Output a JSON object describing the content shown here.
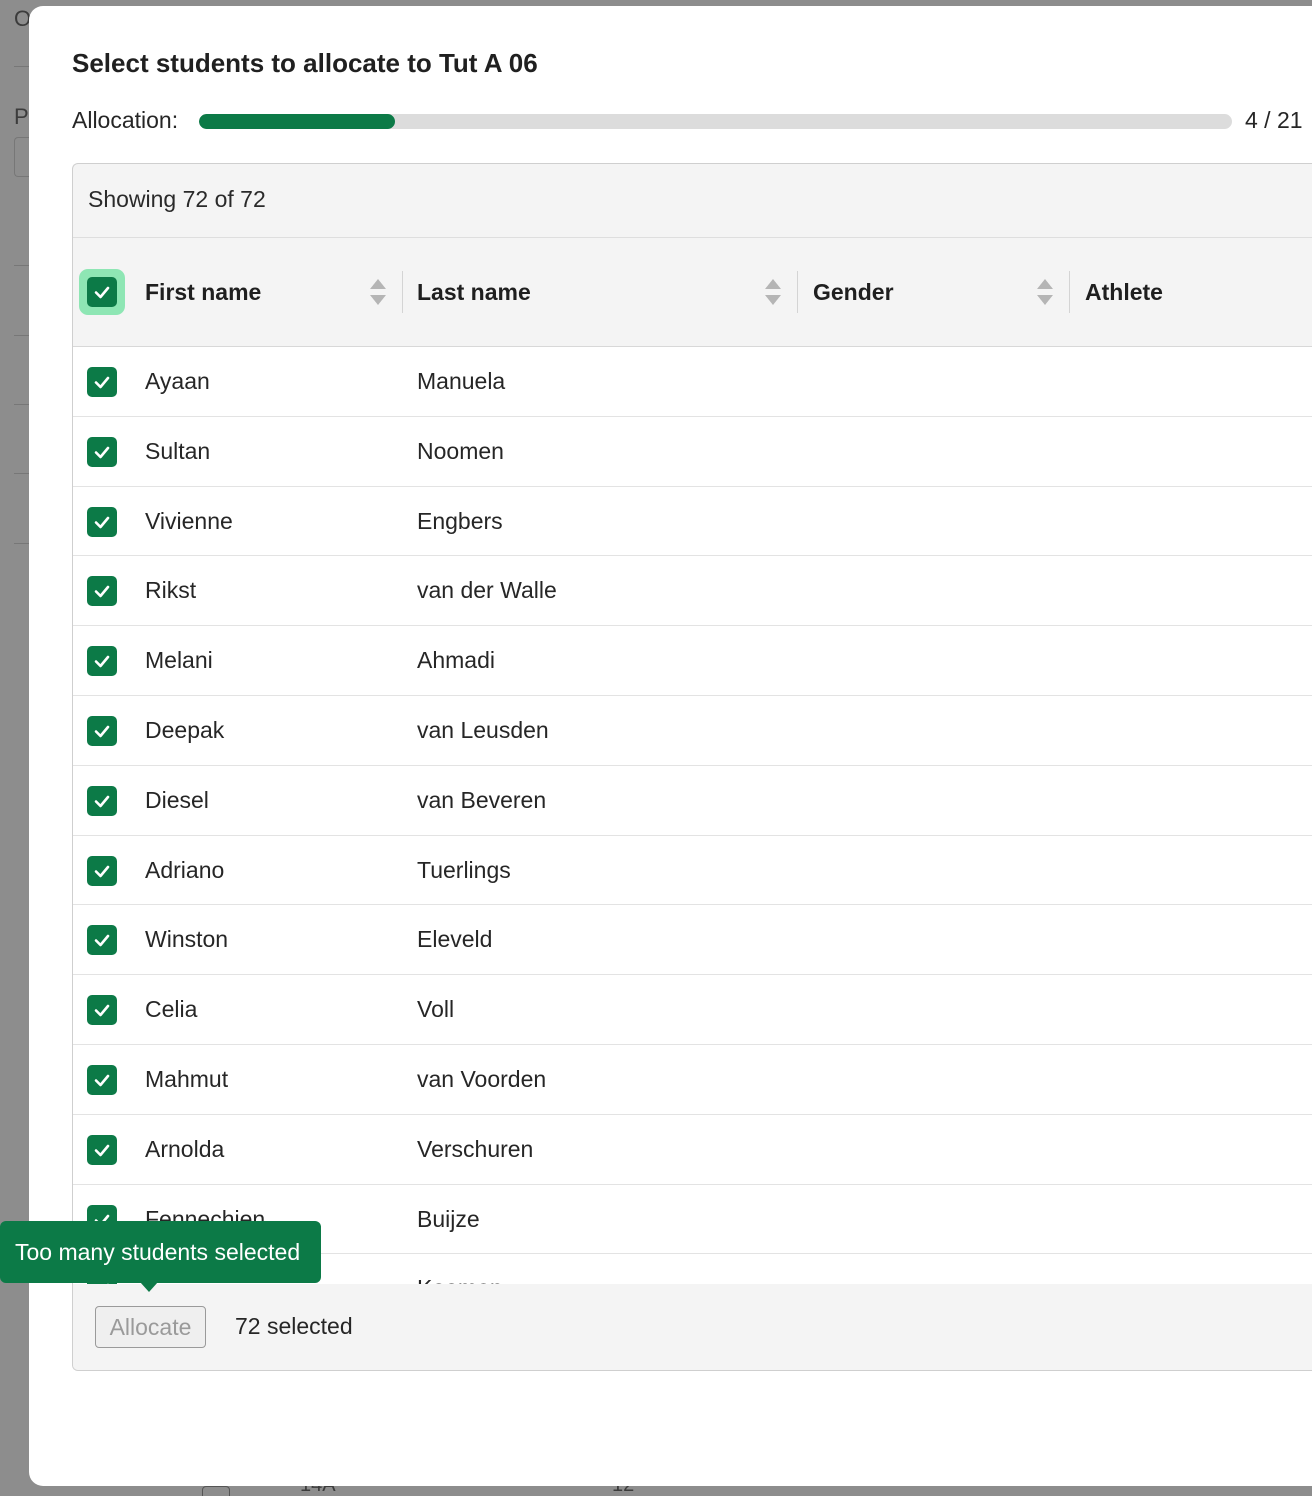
{
  "background": {
    "fragments": [
      "O",
      "P",
      "14A",
      "12"
    ]
  },
  "modal": {
    "title": "Select students to allocate to Tut A 06",
    "allocation_label": "Allocation:",
    "allocation_count": "4 / 21",
    "allocation_progress": 0.19,
    "showing_text": "Showing 72 of 72",
    "columns": {
      "first_name": "First name",
      "last_name": "Last name",
      "gender": "Gender",
      "athlete": "Athlete"
    },
    "select_all_checked": true,
    "rows": [
      {
        "first": "Ayaan",
        "last": "Manuela",
        "checked": true
      },
      {
        "first": "Sultan",
        "last": "Noomen",
        "checked": true
      },
      {
        "first": "Vivienne",
        "last": "Engbers",
        "checked": true
      },
      {
        "first": "Rikst",
        "last": "van der Walle",
        "checked": true
      },
      {
        "first": "Melani",
        "last": "Ahmadi",
        "checked": true
      },
      {
        "first": "Deepak",
        "last": "van Leusden",
        "checked": true
      },
      {
        "first": "Diesel",
        "last": "van Beveren",
        "checked": true
      },
      {
        "first": "Adriano",
        "last": "Tuerlings",
        "checked": true
      },
      {
        "first": "Winston",
        "last": "Eleveld",
        "checked": true
      },
      {
        "first": "Celia",
        "last": "Voll",
        "checked": true
      },
      {
        "first": "Mahmut",
        "last": "van Voorden",
        "checked": true
      },
      {
        "first": "Arnolda",
        "last": "Verschuren",
        "checked": true
      },
      {
        "first": "Fennechien",
        "last": "Buijze",
        "checked": true
      },
      {
        "first": "",
        "last": "Kooman",
        "checked": true
      }
    ],
    "footer": {
      "allocate_label": "Allocate",
      "selected_text": "72 selected"
    },
    "tooltip": "Too many students selected"
  },
  "colors": {
    "accent": "#0c7a47",
    "select_all_ring": "#8ee6b4",
    "progress_track": "#dcdcdc"
  }
}
